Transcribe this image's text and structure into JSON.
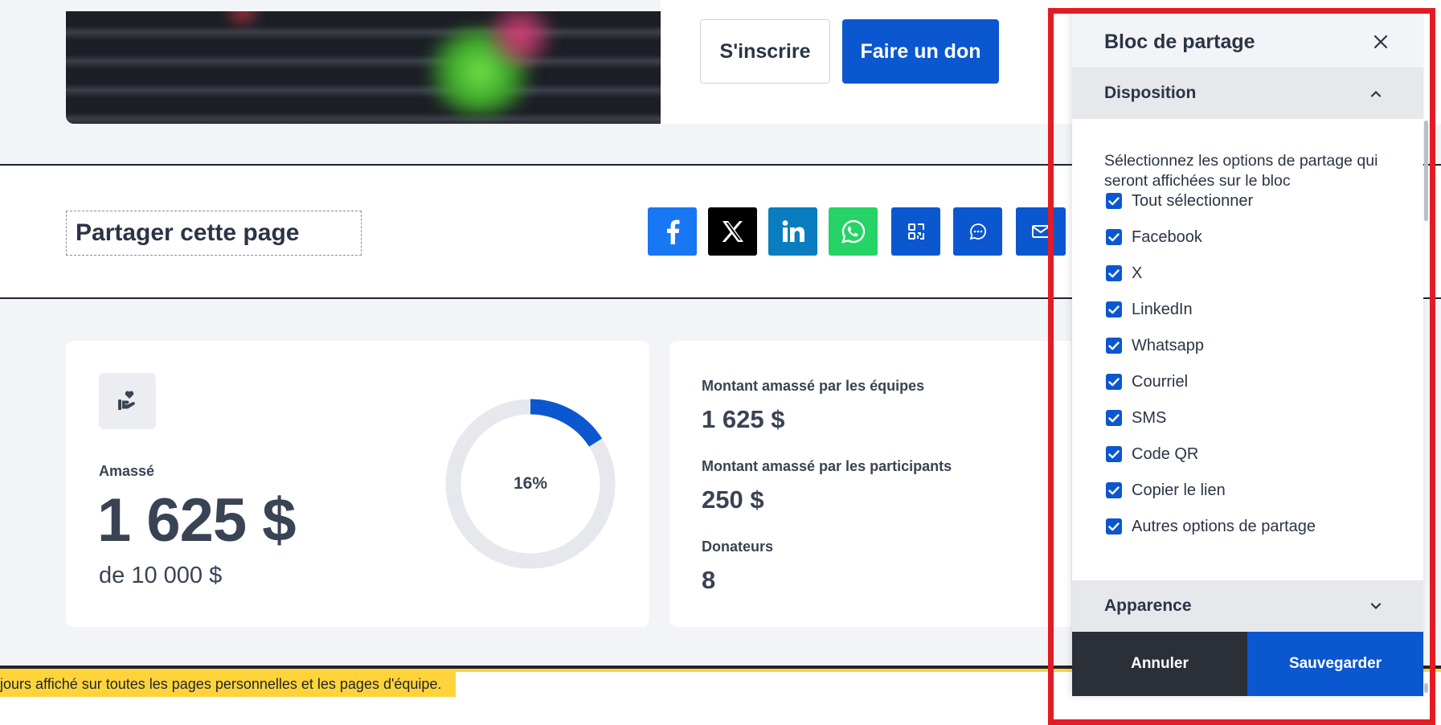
{
  "hero": {
    "signup_label": "S'inscrire",
    "donate_label": "Faire un don"
  },
  "share": {
    "title": "Partager cette page",
    "colors": {
      "facebook": "#1877f2",
      "x": "#000000",
      "linkedin": "#0a7cc0",
      "whatsapp": "#25d366",
      "brand": "#0b57d0"
    },
    "icons": [
      "facebook-icon",
      "x-icon",
      "linkedin-icon",
      "whatsapp-icon",
      "qr-code-icon",
      "sms-icon",
      "email-icon"
    ]
  },
  "stats": {
    "raised_label": "Amassé",
    "raised_value": "1 625 $",
    "goal_text": "de 10 000 $",
    "progress_percent": 16,
    "progress_label": "16%",
    "teams_label": "Montant amassé par les équipes",
    "teams_value": "1 625 $",
    "participants_label": "Montant amassé par les participants",
    "participants_value": "250 $",
    "donors_label": "Donateurs",
    "donors_value": "8"
  },
  "notice": {
    "text": "jours affiché sur toutes les pages personnelles et les pages d'équipe."
  },
  "panel": {
    "title": "Bloc de partage",
    "layout_section": "Disposition",
    "description": "Sélectionnez les options de partage qui seront affichées sur le bloc",
    "options": [
      {
        "label": "Tout sélectionner",
        "checked": true
      },
      {
        "label": "Facebook",
        "checked": true
      },
      {
        "label": "X",
        "checked": true
      },
      {
        "label": "LinkedIn",
        "checked": true
      },
      {
        "label": "Whatsapp",
        "checked": true
      },
      {
        "label": "Courriel",
        "checked": true
      },
      {
        "label": "SMS",
        "checked": true
      },
      {
        "label": "Code QR",
        "checked": true
      },
      {
        "label": "Copier le lien",
        "checked": true
      },
      {
        "label": "Autres options de partage",
        "checked": true
      }
    ],
    "appearance_section": "Apparence",
    "cancel_label": "Annuler",
    "save_label": "Sauvegarder",
    "highlight_color": "#e31b23"
  }
}
